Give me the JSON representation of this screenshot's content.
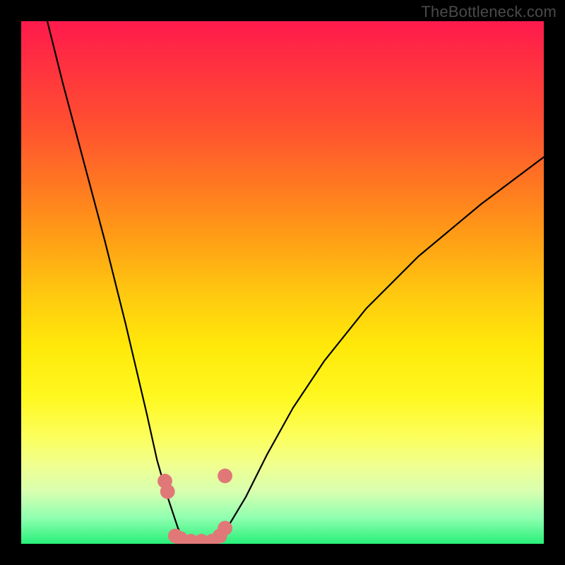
{
  "watermark": "TheBottleneck.com",
  "chart_data": {
    "type": "line",
    "title": "",
    "xlabel": "",
    "ylabel": "",
    "xlim": [
      0,
      100
    ],
    "ylim": [
      0,
      100
    ],
    "grid": false,
    "legend": false,
    "gradient_bands": [
      {
        "color": "#ff1a4d",
        "stop": 0
      },
      {
        "color": "#ff7a20",
        "stop": 32
      },
      {
        "color": "#ffe80a",
        "stop": 62
      },
      {
        "color": "#fbff60",
        "stop": 80
      },
      {
        "color": "#28f07a",
        "stop": 100
      }
    ],
    "series": [
      {
        "name": "left-curve",
        "color": "#000000",
        "x": [
          5,
          8,
          12,
          16,
          20,
          24,
          26,
          28,
          30,
          31,
          32,
          33
        ],
        "y": [
          100,
          88,
          73,
          58,
          42,
          25,
          16,
          9,
          3,
          1,
          0,
          0
        ]
      },
      {
        "name": "right-curve",
        "color": "#000000",
        "x": [
          37,
          38,
          40,
          43,
          47,
          52,
          58,
          66,
          76,
          88,
          100
        ],
        "y": [
          0,
          1,
          4,
          9,
          17,
          26,
          35,
          45,
          55,
          65,
          74
        ]
      }
    ],
    "markers": [
      {
        "name": "dot",
        "x": 27.5,
        "y": 12,
        "r": 1.4,
        "color": "#e07878"
      },
      {
        "name": "dot",
        "x": 28.0,
        "y": 10,
        "r": 1.4,
        "color": "#e07878"
      },
      {
        "name": "dot",
        "x": 29.5,
        "y": 1.5,
        "r": 1.4,
        "color": "#e07878"
      },
      {
        "name": "dot",
        "x": 30.5,
        "y": 1.0,
        "r": 1.4,
        "color": "#e07878"
      },
      {
        "name": "dot",
        "x": 32.5,
        "y": 0.5,
        "r": 1.4,
        "color": "#e07878"
      },
      {
        "name": "dot",
        "x": 34.5,
        "y": 0.5,
        "r": 1.4,
        "color": "#e07878"
      },
      {
        "name": "dot",
        "x": 36.5,
        "y": 0.5,
        "r": 1.4,
        "color": "#e07878"
      },
      {
        "name": "dot",
        "x": 38.0,
        "y": 1.5,
        "r": 1.4,
        "color": "#e07878"
      },
      {
        "name": "dot",
        "x": 39.0,
        "y": 3.0,
        "r": 1.4,
        "color": "#e07878"
      },
      {
        "name": "dot",
        "x": 39.0,
        "y": 13.0,
        "r": 1.4,
        "color": "#e07878"
      }
    ]
  }
}
